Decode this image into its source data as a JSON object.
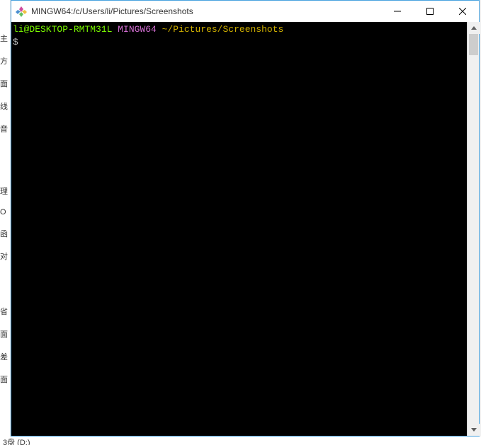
{
  "window": {
    "title": "MINGW64:/c/Users/li/Pictures/Screenshots"
  },
  "terminal": {
    "prompt_user": "li@DESKTOP-RMTM31L",
    "prompt_host": "MINGW64",
    "prompt_path": "~/Pictures/Screenshots",
    "prompt_symbol": "$"
  },
  "bg_left_items": [
    "主",
    "方",
    "面",
    "线",
    "音",
    "理",
    "O",
    "函",
    "对",
    "省",
    "面",
    "差",
    "面"
  ],
  "bg_bottom": "3盘 (D:)"
}
